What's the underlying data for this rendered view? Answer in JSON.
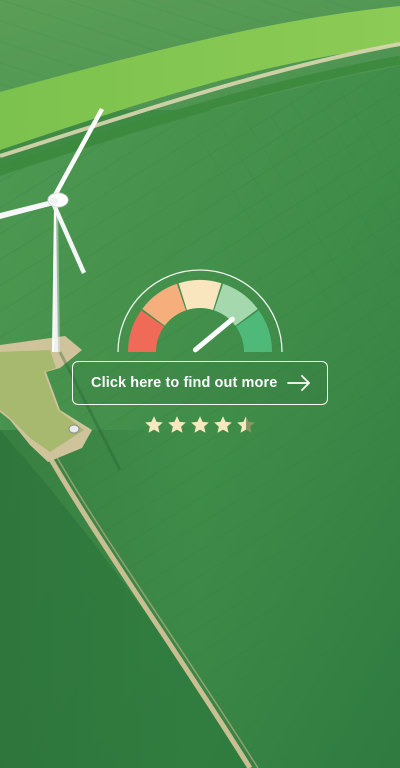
{
  "cta": {
    "label": "Click here to find out more",
    "arrow_icon": "arrow-right-icon"
  },
  "gauge": {
    "icon": "speedometer-icon",
    "segments": [
      "#ef6a57",
      "#f6ae7d",
      "#f9e6bf",
      "#a5d8ad",
      "#4fb979"
    ],
    "needle_level": 0.78
  },
  "rating": {
    "value": 4.5,
    "max": 5,
    "star_color": "#f7e9bf",
    "icon": "star-icon"
  },
  "colors": {
    "cta_border": "#ffffff",
    "cta_text": "#ffffff"
  }
}
